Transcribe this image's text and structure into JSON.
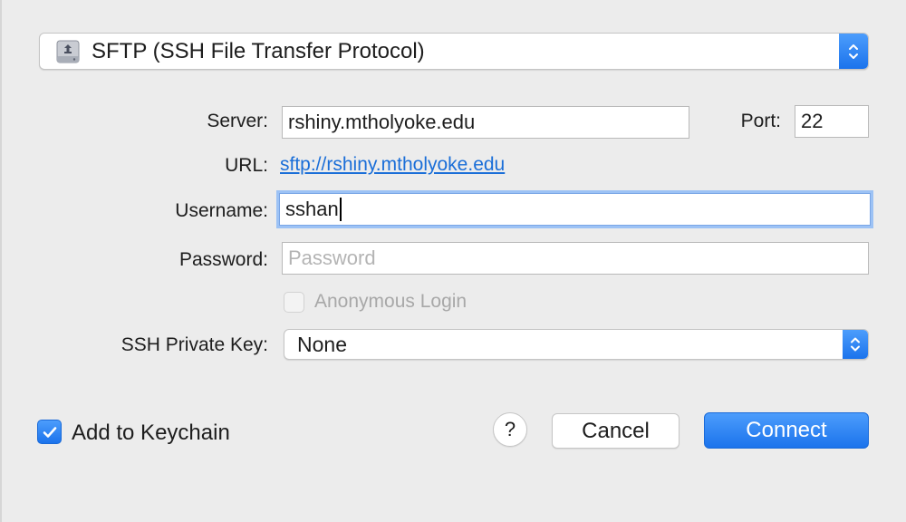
{
  "protocol": {
    "selected": "SFTP (SSH File Transfer Protocol)",
    "icon": "network-drive-icon"
  },
  "server": {
    "label": "Server:",
    "value": "rshiny.mtholyoke.edu"
  },
  "port": {
    "label": "Port:",
    "value": "22"
  },
  "url": {
    "label": "URL:",
    "value": "sftp://rshiny.mtholyoke.edu"
  },
  "username": {
    "label": "Username:",
    "value": "sshan"
  },
  "password": {
    "label": "Password:",
    "value": "",
    "placeholder": "Password"
  },
  "anonymous": {
    "label": "Anonymous Login",
    "checked": false,
    "enabled": false
  },
  "ssh_key": {
    "label": "SSH Private Key:",
    "selected": "None"
  },
  "keychain": {
    "label": "Add to Keychain",
    "checked": true
  },
  "buttons": {
    "help": "?",
    "cancel": "Cancel",
    "connect": "Connect"
  },
  "colors": {
    "accent": "#1b73ec",
    "link": "#1a6ed8",
    "background": "#ececec"
  }
}
